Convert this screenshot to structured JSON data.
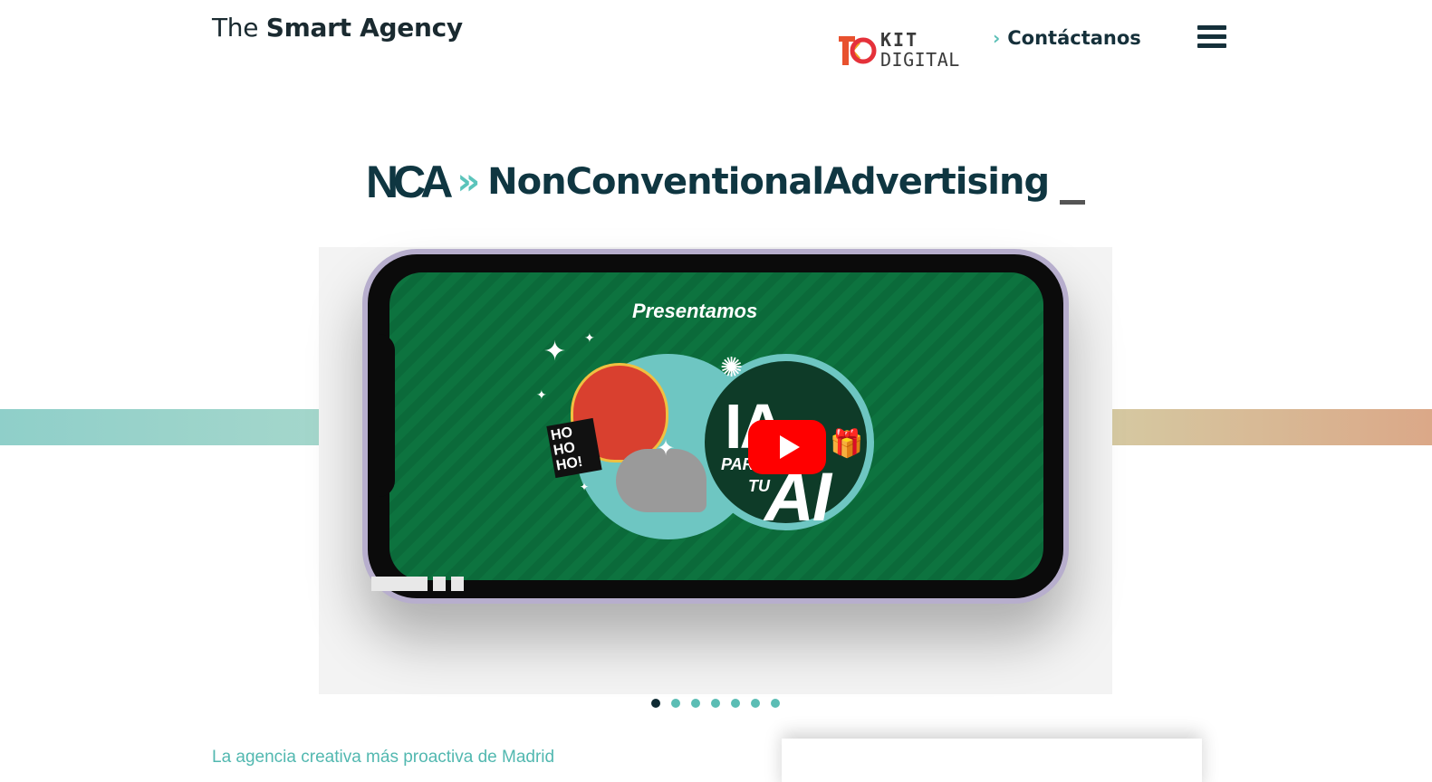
{
  "header": {
    "logo_prefix": "The",
    "logo_bold": "Smart Agency",
    "kit_line1": "KIT",
    "kit_line2": "DIGITAL",
    "contact_label": "Contáctanos",
    "contact_chevron": "›",
    "menu_icon": "hamburger-icon"
  },
  "hero": {
    "brand_mark": "NCA",
    "brand_arrows": "»",
    "title": "NonConventionalAdvertising",
    "cursor": "_"
  },
  "video": {
    "screen_text_top": "Presentamos",
    "screen_text_ia": "IA",
    "screen_text_para": "PARA",
    "screen_text_tu": "TU",
    "screen_text_ai": "AI",
    "hoho": "HO HO HO!",
    "play_icon": "youtube-play-icon"
  },
  "carousel": {
    "dots": 7,
    "active_index": 0
  },
  "footer": {
    "tagline": "La agencia creativa más proactiva de Madrid"
  },
  "colors": {
    "brand_dark": "#0f3641",
    "accent_teal": "#5bc4bb",
    "youtube_red": "#ff0000"
  }
}
